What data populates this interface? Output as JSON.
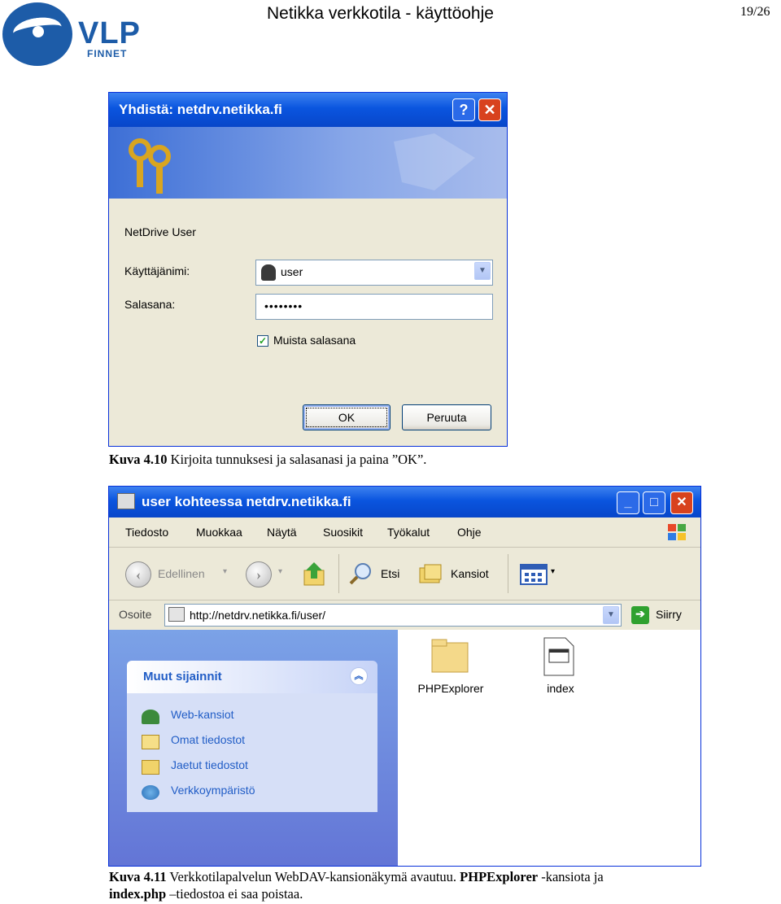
{
  "header": {
    "logo_text": "VLP",
    "logo_sub": "FINNET",
    "doc_title": "Netikka verkkotila - käyttöohje",
    "page": "19/26"
  },
  "dialog": {
    "title": "Yhdistä: netdrv.netikka.fi",
    "help_label": "?",
    "close_label": "✕",
    "heading": "NetDrive User",
    "username_label": "Käyttäjänimi:",
    "username_value": "user",
    "password_label": "Salasana:",
    "password_value": "••••••••",
    "remember_label": "Muista salasana",
    "remember_checked": true,
    "ok_label": "OK",
    "cancel_label": "Peruuta"
  },
  "caption1": {
    "bold": "Kuva 4.10",
    "text": " Kirjoita tunnuksesi ja salasanasi ja paina ”OK”."
  },
  "explorer": {
    "title": "user kohteessa netdrv.netikka.fi",
    "menu": [
      "Tiedosto",
      "Muokkaa",
      "Näytä",
      "Suosikit",
      "Työkalut",
      "Ohje"
    ],
    "toolbar": {
      "back": "Edellinen",
      "search": "Etsi",
      "folders": "Kansiot"
    },
    "address_label": "Osoite",
    "address_value": "http://netdrv.netikka.fi/user/",
    "go_label": "Siirry",
    "panel_title": "Muut sijainnit",
    "panel_items": [
      "Web-kansiot",
      "Omat tiedostot",
      "Jaetut tiedostot",
      "Verkkoympäristö"
    ],
    "files": [
      "PHPExplorer",
      "index"
    ]
  },
  "caption2": {
    "bold1": "Kuva 4.11",
    "text1": " Verkkotilapalvelun WebDAV-kansionäkymä avautuu. ",
    "bold2": "PHPExplorer",
    "text2": " -kansiota  ja",
    "bold3": "index.php",
    "text3": " –tiedostoa ei saa poistaa."
  }
}
